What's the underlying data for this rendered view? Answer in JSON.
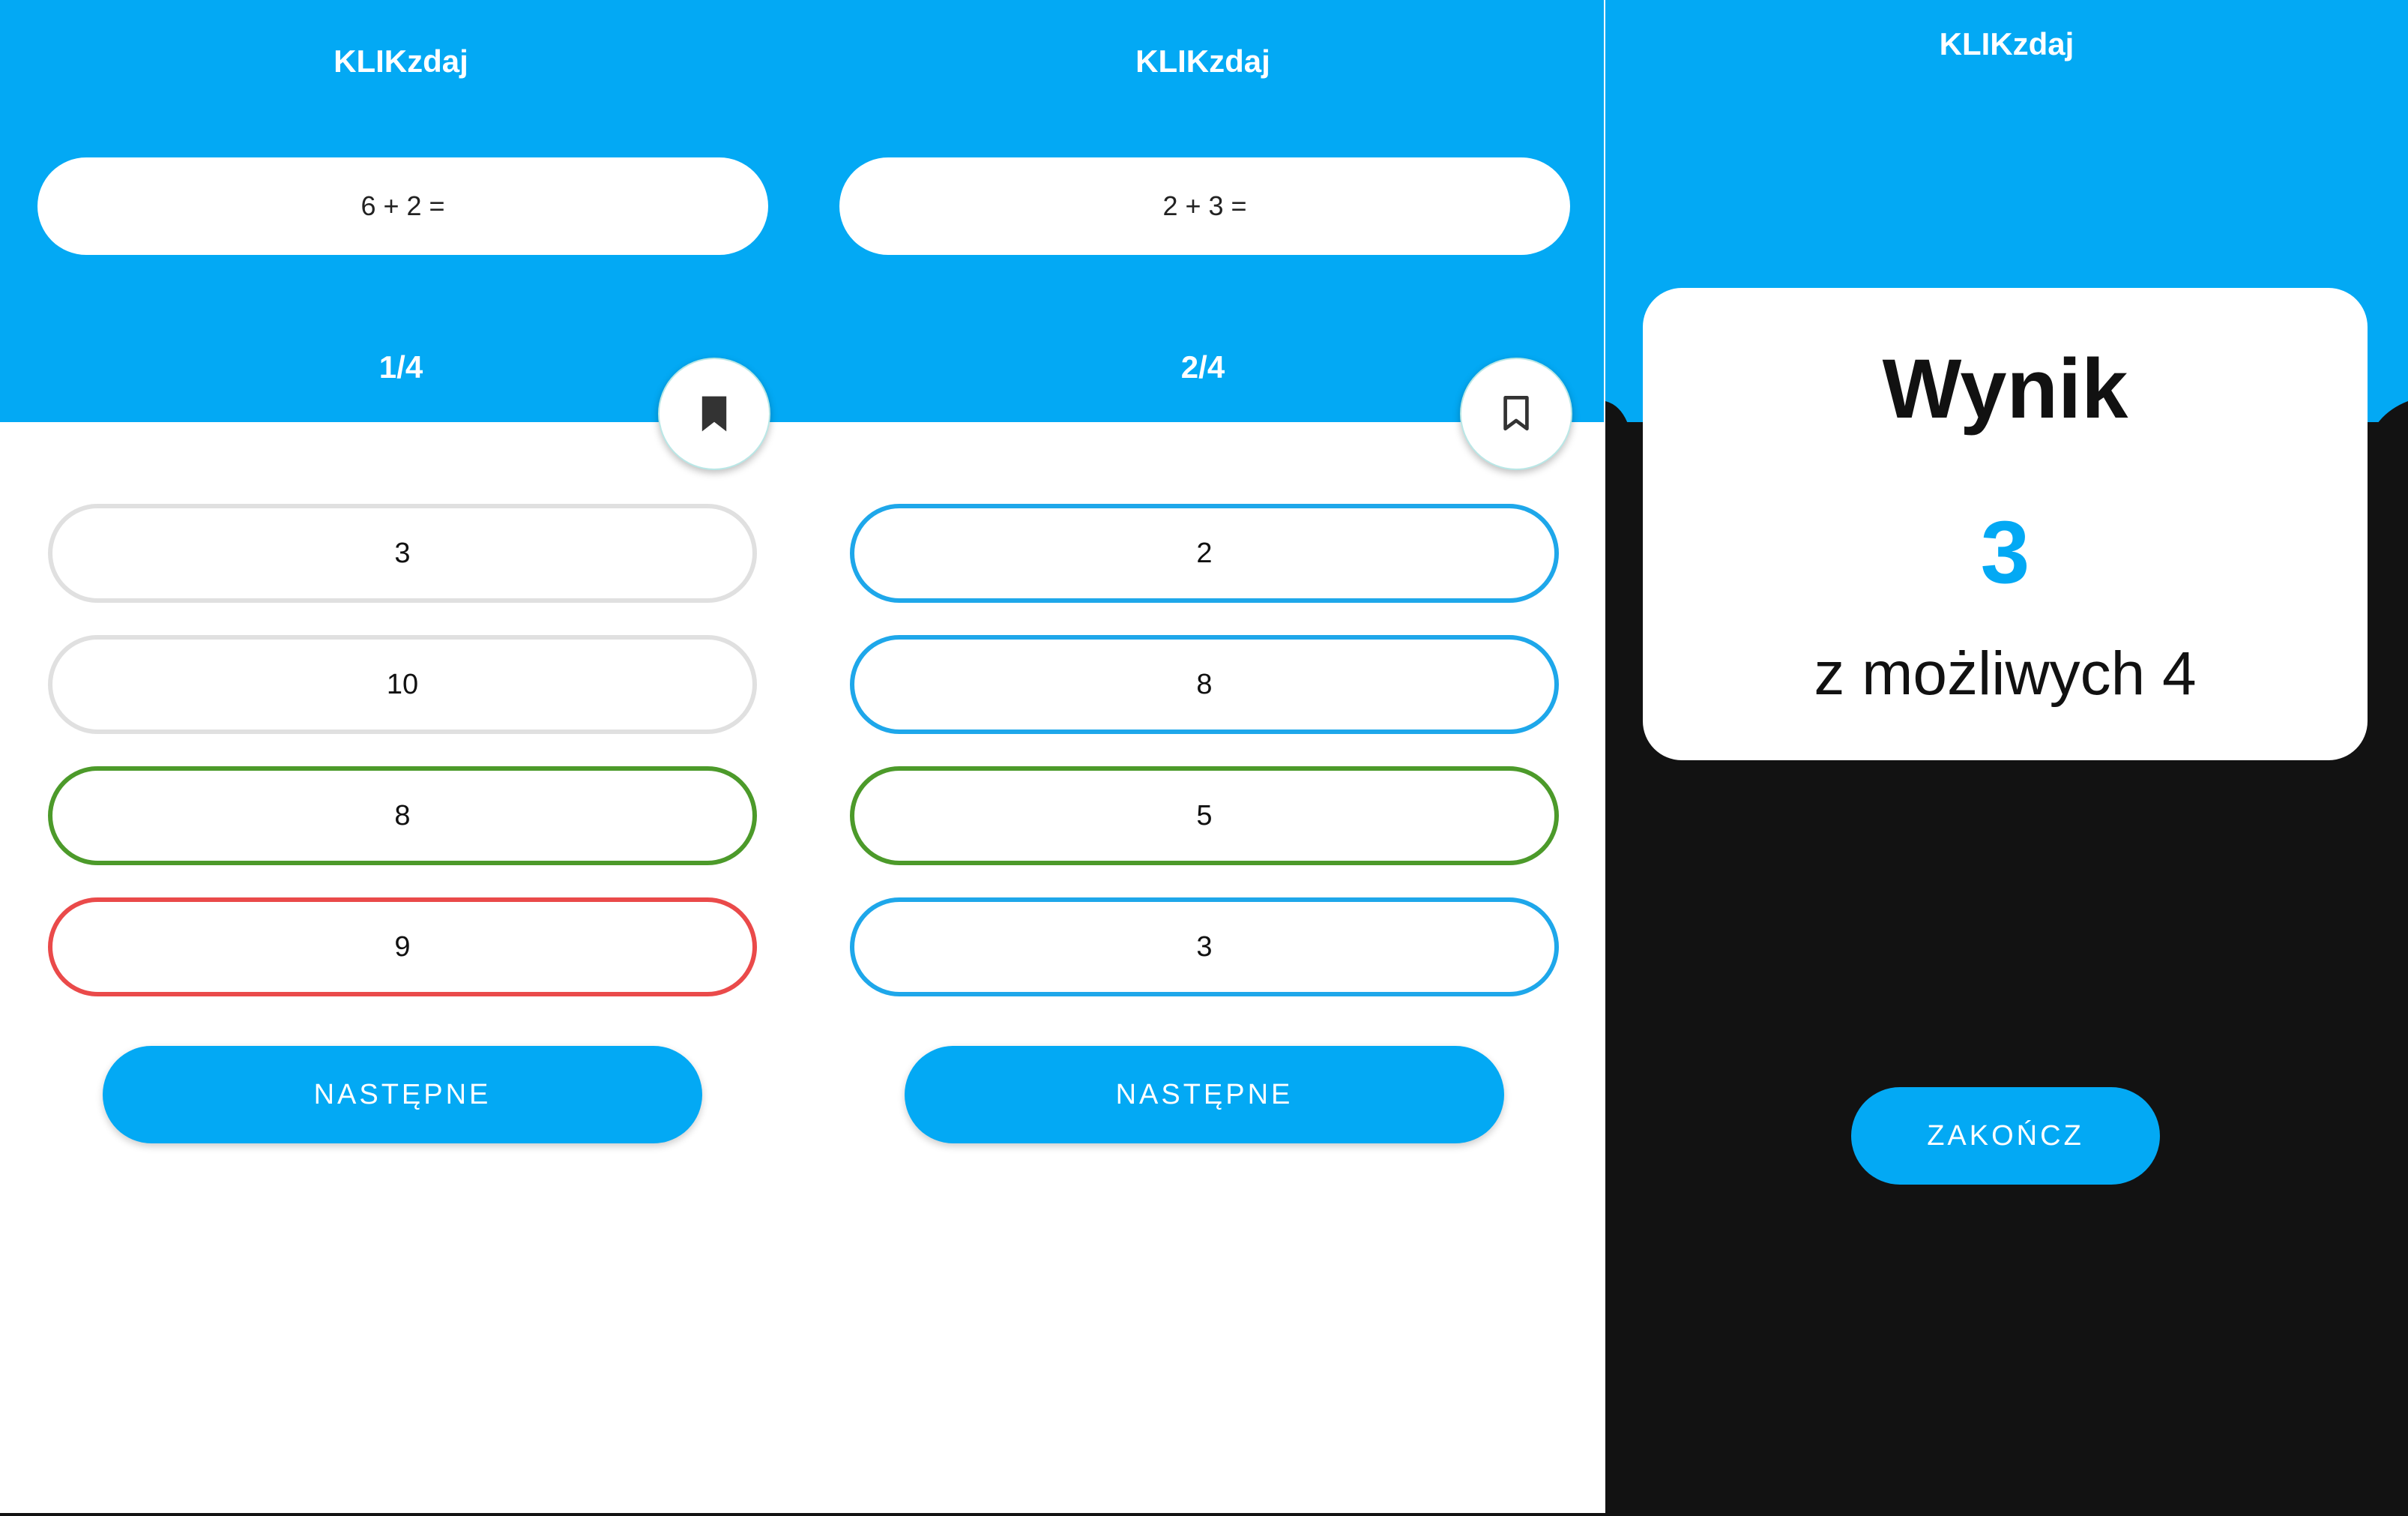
{
  "app": {
    "title": "KLIKzdaj"
  },
  "colors": {
    "primary": "#03a9f4",
    "correct": "#4c9a2a",
    "wrong": "#ea4a4a",
    "neutral_border": "#e0e0e0",
    "dark_background": "#121212"
  },
  "screens": [
    {
      "question": "6 + 2 =",
      "counter": "1/4",
      "bookmark_icon": "bookmark-filled-icon",
      "answers": [
        {
          "label": "3",
          "state": "neutral"
        },
        {
          "label": "10",
          "state": "neutral"
        },
        {
          "label": "8",
          "state": "correct"
        },
        {
          "label": "9",
          "state": "wrong"
        }
      ],
      "next_label": "NASTĘPNE"
    },
    {
      "question": "2 + 3 =",
      "counter": "2/4",
      "bookmark_icon": "bookmark-outline-icon",
      "answers": [
        {
          "label": "2",
          "state": "option"
        },
        {
          "label": "8",
          "state": "option"
        },
        {
          "label": "5",
          "state": "correct"
        },
        {
          "label": "3",
          "state": "option"
        }
      ],
      "next_label": "NASTĘPNE"
    }
  ],
  "result": {
    "title": "Wynik",
    "score": "3",
    "subtitle": "z możliwych 4",
    "finish_label": "ZAKOŃCZ"
  }
}
